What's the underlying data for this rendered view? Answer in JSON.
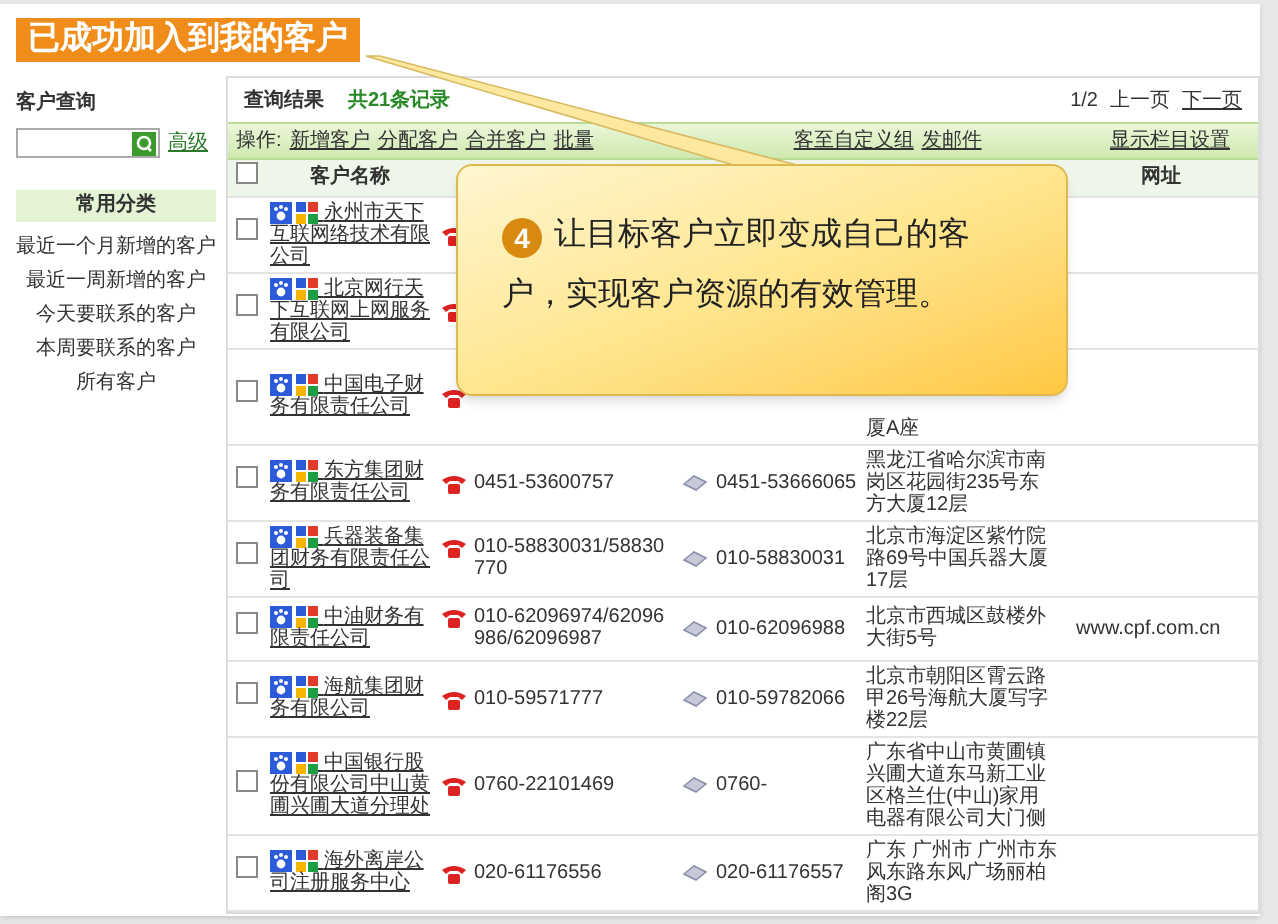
{
  "banner": "已成功加入到我的客户",
  "sidebar": {
    "title": "客户查询",
    "advanced_link": "高级",
    "category_header": "常用分类",
    "items": [
      "最近一个月新增的客户",
      "最近一周新增的客户",
      "今天要联系的客户",
      "本周要联系的客户",
      "所有客户"
    ]
  },
  "results": {
    "title": "查询结果",
    "count": "共21条记录",
    "pagination": {
      "page": "1/2",
      "prev": "上一页",
      "next": "下一页"
    }
  },
  "toolbar": {
    "label": "操作:",
    "actions": [
      "新增客户",
      "分配客户",
      "合并客户",
      "批量",
      "客至自定义组",
      "发邮件"
    ],
    "settings_link": "显示栏目设置"
  },
  "table": {
    "select_all_checked": false,
    "name_header": "客户名称",
    "website_header": "网址",
    "rows": [
      {
        "checked": false,
        "name": "永州市天下互联网络技术有限公司"
      },
      {
        "checked": false,
        "name": "北京网行天下互联网上网服务有限公司"
      },
      {
        "checked": false,
        "name": "中国电子财务有限责任公司",
        "address": "厦A座"
      },
      {
        "checked": false,
        "name": "东方集团财务有限责任公司",
        "phone": "0451-53600757",
        "fax": "0451-53666065",
        "address": "黑龙江省哈尔滨市南岗区花园街235号东方大厦12层"
      },
      {
        "checked": false,
        "name": "兵器装备集团财务有限责任公司",
        "phone": "010-58830031/58830770",
        "fax": "010-58830031",
        "address": "北京市海淀区紫竹院路69号中国兵器大厦17层"
      },
      {
        "checked": false,
        "name": "中油财务有限责任公司",
        "phone": "010-62096974/62096986/62096987",
        "fax": "010-62096988",
        "address": "北京市西城区鼓楼外大街5号",
        "website": "www.cpf.com.cn"
      },
      {
        "checked": false,
        "name": "海航集团财务有限公司",
        "phone": "010-59571777",
        "fax": "010-59782066",
        "address": "北京市朝阳区霄云路甲26号海航大厦写字楼22层"
      },
      {
        "checked": false,
        "name": "中国银行股份有限公司中山黄圃兴圃大道分理处",
        "phone": "0760-22101469",
        "fax": "0760-",
        "address": "广东省中山市黄圃镇兴圃大道东马新工业区格兰仕(中山)家用电器有限公司大门侧"
      },
      {
        "checked": false,
        "name": "海外离岸公司注册服务中心",
        "phone": "020-61176556",
        "fax": "020-61176557",
        "address": "广东 广州市 广州市东风东路东风广场丽柏阁3G"
      }
    ]
  },
  "callout": {
    "step": "4",
    "text": "让目标客户立即变成自己的客户，实现客户资源的有效管理。"
  }
}
